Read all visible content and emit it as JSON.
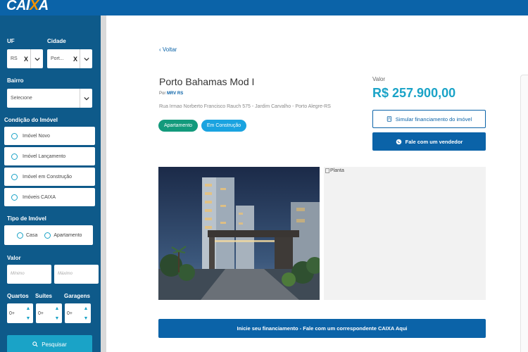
{
  "header": {
    "logo_text": "CAIXA"
  },
  "sidebar": {
    "uf_label": "UF",
    "uf_value": "RS",
    "cidade_label": "Cidade",
    "cidade_value": "Port...",
    "bairro_label": "Bairro",
    "bairro_value": "Selecione",
    "condicao_label": "Condição do Imóvel",
    "condicao_options": [
      "Imóvel Novo",
      "Imóvel Lançamento",
      "Imóvel em Construção",
      "Imóveis CAIXA"
    ],
    "tipo_label": "Tipo de Imóvel",
    "tipo_options": [
      "Casa",
      "Apartamento"
    ],
    "valor_label": "Valor",
    "valor_min_placeholder": "Mínimo",
    "valor_max_placeholder": "Máximo",
    "quartos_label": "Quartos",
    "suites_label": "Suítes",
    "garagens_label": "Garagens",
    "quartos_value": "0+",
    "suites_value": "0+",
    "garagens_value": "0+",
    "search_label": "Pesquisar",
    "clear_symbol": "X"
  },
  "main": {
    "back_label": "Voltar",
    "title": "Porto Bahamas Mod I",
    "por_prefix": "Por",
    "builder": "MRV RS",
    "address": "Rua Irmao Norberto Francisco Rauch 575 - Jardim Carvalho - Porto Alegre-RS",
    "badges": [
      "Apartamento",
      "Em Construção"
    ],
    "valor_label": "Valor",
    "price": "R$  257.900,00",
    "simulate_label": "Simular financiamento do imóvel",
    "vendor_label": "Fale com um vendedor",
    "planta_alt": "Planta",
    "cta_label": "Inicie seu financiamento - Fale com um correspondente CAIXA Aqui"
  },
  "colors": {
    "brand_blue": "#0b63a8",
    "sidebar_blue": "#0e5a8a",
    "accent_cyan": "#1aa3c7",
    "badge_green": "#139a7c",
    "badge_blue": "#1aa3e0",
    "logo_orange": "#f39200"
  }
}
